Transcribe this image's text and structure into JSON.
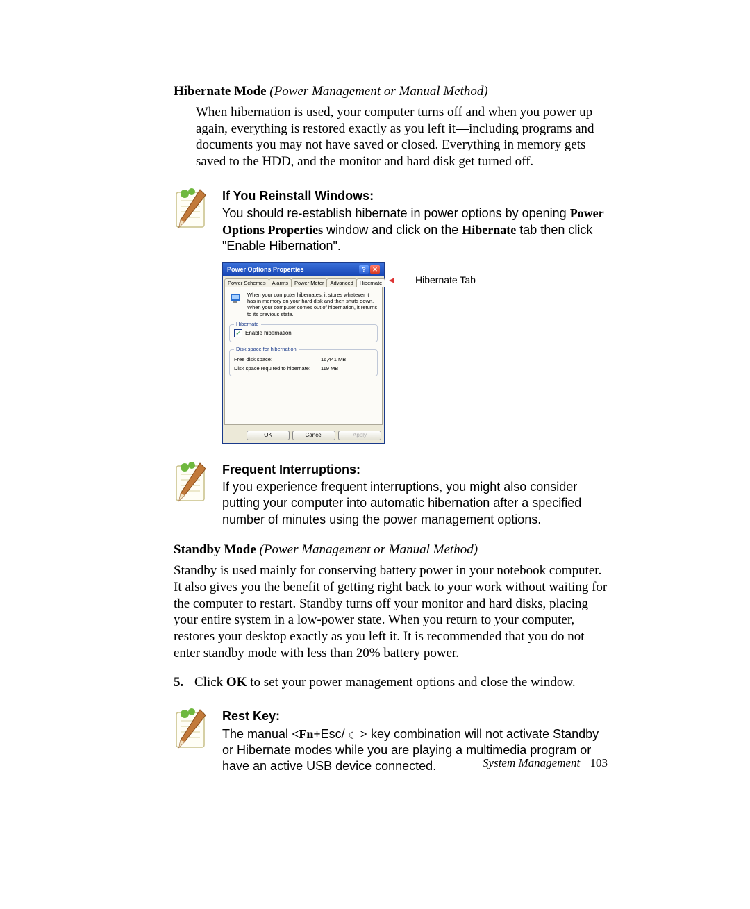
{
  "section_hibernate": {
    "title_bold": "Hibernate Mode",
    "title_ital": "(Power Management or Manual Method)",
    "body": "When hibernation is used, your computer turns off and when you power up again, everything is restored exactly as you left it—including programs and documents you may not have saved or closed. Everything in memory gets saved to the HDD, and the monitor and hard disk get turned off."
  },
  "note_reinstall": {
    "title": "If You Reinstall Windows:",
    "pre": "You should re-establish hibernate in power options by opening ",
    "b1": "Power Options Properties",
    "mid": " window and click on the ",
    "b2": "Hibernate",
    "post": " tab then click \"Enable Hibernation\"."
  },
  "dialog": {
    "title": "Power Options Properties",
    "help_glyph": "?",
    "close_glyph": "✕",
    "tabs": [
      "Power Schemes",
      "Alarms",
      "Power Meter",
      "Advanced",
      "Hibernate"
    ],
    "callout": "Hibernate Tab",
    "desc": "When your computer hibernates, it stores whatever it has in memory on your hard disk and then shuts down. When your computer comes out of hibernation, it returns to its previous state.",
    "group_hib": "Hibernate",
    "enable_label": "Enable hibernation",
    "group_disk": "Disk space for hibernation",
    "free_label": "Free disk space:",
    "free_value": "16,441 MB",
    "req_label": "Disk space required to hibernate:",
    "req_value": "119 MB",
    "ok": "OK",
    "cancel": "Cancel",
    "apply": "Apply"
  },
  "note_frequent": {
    "title": "Frequent Interruptions:",
    "body": "If you experience frequent interruptions, you might also consider putting your computer into automatic hibernation after a specified number of minutes using the power management options."
  },
  "section_standby": {
    "title_bold": "Standby Mode",
    "title_ital": "(Power Management or Manual Method)",
    "body": "Standby is used mainly for conserving battery power in your notebook computer. It also gives you the benefit of getting right back to your work without waiting for the computer to restart. Standby turns off your monitor and hard disks, placing your entire system in a low-power state. When you return to your computer, restores your desktop exactly as you left it. It is recommended that you do not enter standby mode with less than 20% battery power."
  },
  "step5": {
    "num": "5.",
    "pre": "Click ",
    "b": "OK",
    "post": " to set your power management options and close the window."
  },
  "note_rest": {
    "title": "Rest Key:",
    "pre": "The manual ",
    "b1": "<Fn+",
    "mid1": "Esc/ ",
    "b2": " >",
    "post": " key combination will not activate Standby or Hibernate modes while you are playing a multimedia program or have an active USB device connected."
  },
  "footer": {
    "label": "System Management",
    "page": "103"
  }
}
